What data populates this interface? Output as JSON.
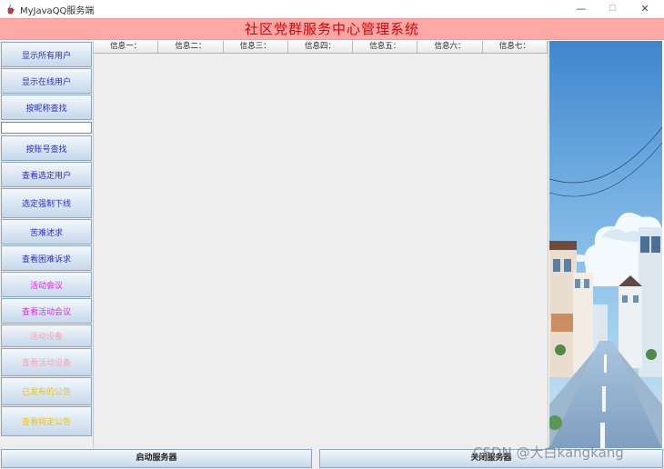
{
  "window": {
    "title": "MyJavaQQ服务端",
    "icon": "java-cup-icon",
    "controls": {
      "minimize": "—",
      "maximize": "☐",
      "close": "✕"
    }
  },
  "banner": {
    "title": "社区党群服务中心管理系统",
    "color": "#e00000"
  },
  "sidebar": {
    "buttons": [
      {
        "label": "显示所有用户",
        "color": "#2a2ad8"
      },
      {
        "label": "显示在线用户",
        "color": "#2a2ad8"
      },
      {
        "label": "按昵称查找",
        "color": "#2a2ad8"
      },
      {
        "label": "按账号查找",
        "color": "#2a2ad8"
      },
      {
        "label": "查看选定用户",
        "color": "#2a2ad8"
      },
      {
        "label": "选定强制下线",
        "color": "#2a2ad8"
      },
      {
        "label": "苦难述求",
        "color": "#2a2ad8"
      },
      {
        "label": "查看困难诉求",
        "color": "#2a2ad8"
      },
      {
        "label": "活动会议",
        "color": "#e22ae2"
      },
      {
        "label": "查看活动会议",
        "color": "#e22ae2"
      },
      {
        "label": "活动设备",
        "color": "#f2a6b6"
      },
      {
        "label": "查看活动设备",
        "color": "#f2a6b6"
      },
      {
        "label": "已发布的公告",
        "color": "#e6c21c"
      },
      {
        "label": "查看特定公告",
        "color": "#e6c21c"
      }
    ],
    "search_value": ""
  },
  "table": {
    "headers": [
      "信息一：",
      "信息二：",
      "信息三：",
      "信息四：",
      "信息五：",
      "信息六：",
      "信息七："
    ],
    "rows": []
  },
  "footer": {
    "start_label": "启动服务器",
    "stop_label": "关闭服务器"
  },
  "watermark": "CSDN @大白kangkang"
}
